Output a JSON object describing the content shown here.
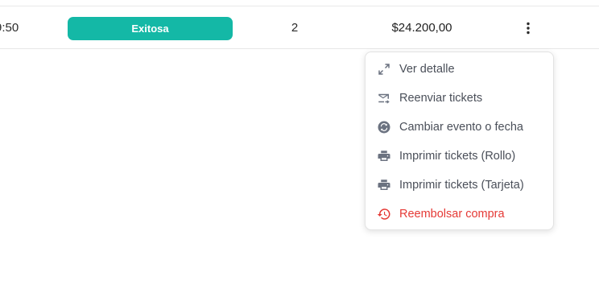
{
  "row": {
    "time_partial": "9:50",
    "status": "Exitosa",
    "quantity": "2",
    "total": "$24.200,00"
  },
  "colors": {
    "status_badge": "#14b8a6",
    "menu_text": "#4a4f59",
    "danger": "#e53935"
  },
  "menu": {
    "items": [
      {
        "label": "Ver detalle",
        "icon": "expand-icon"
      },
      {
        "label": "Reenviar tickets",
        "icon": "email-forward-icon"
      },
      {
        "label": "Cambiar evento o fecha",
        "icon": "swap-circle-icon"
      },
      {
        "label": "Imprimir tickets (Rollo)",
        "icon": "printer-icon"
      },
      {
        "label": "Imprimir tickets (Tarjeta)",
        "icon": "printer-icon"
      },
      {
        "label": "Reembolsar compra",
        "icon": "history-icon"
      }
    ]
  }
}
